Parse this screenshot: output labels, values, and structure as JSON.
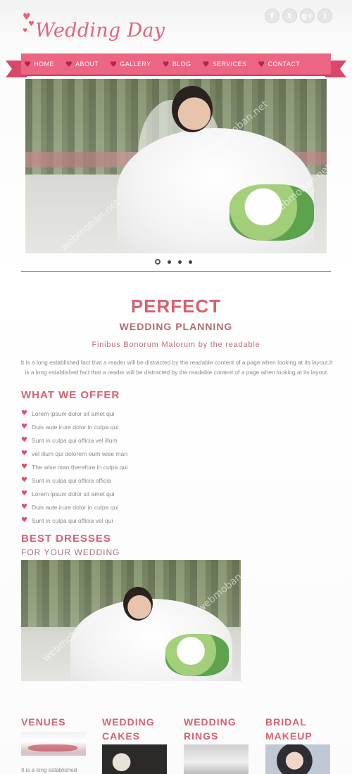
{
  "header": {
    "logo_text": "Wedding Day",
    "social": [
      {
        "icon": "facebook-icon",
        "glyph": "f"
      },
      {
        "icon": "twitter-icon",
        "glyph": "t"
      },
      {
        "icon": "google-plus-icon",
        "glyph": "g+"
      },
      {
        "icon": "rss-icon",
        "glyph": ")"
      }
    ]
  },
  "nav": {
    "items": [
      "HOME",
      "ABOUT",
      "GALLERY",
      "BLOG",
      "SERVICES",
      "CONTACT"
    ]
  },
  "watermark": "webmoban.net",
  "slider": {
    "slide_count": 4,
    "active_index": 0
  },
  "intro": {
    "title": "PERFECT",
    "subtitle": "WEDDING PLANNING",
    "tagline": "Finibus Bonorum Malorum by the readable",
    "body": "It is a long established fact that a reader will be distracted by the readable content of a page when looking at its layout.It is a long established fact that a reader will be distracted by the readable content of a page when looking at its layout."
  },
  "offer": {
    "title": "WHAT WE OFFER",
    "items": [
      "Lorem ipsum dolor sit amet qui",
      "Duis aute irure dolor in culpa qui",
      "Sunt in culpa qui officia vel illum",
      "vel illum qui dolorem eum wise man",
      "The wise man therefore in culpa qui",
      "Sunt in culpa qui officia officia",
      "Lorem ipsum dolor sit amet qui",
      "Duis aute irure dolor in culpa qui",
      "Sunt in culpa qui officia vel qui"
    ]
  },
  "dresses": {
    "title": "BEST DRESSES",
    "subtitle": "FOR YOUR WEDDING"
  },
  "columns": [
    {
      "line1": "VENUES",
      "line2": "",
      "text": "It is a long established"
    },
    {
      "line1": "WEDDING",
      "line2": "CAKES",
      "text": ""
    },
    {
      "line1": "WEDDING",
      "line2": "RINGS",
      "text": ""
    },
    {
      "line1": "BRIDAL",
      "line2": "MAKEUP",
      "text": ""
    }
  ],
  "colors": {
    "accent": "#d86070",
    "ribbon": "#ec6583",
    "heart": "#e24a6c"
  }
}
